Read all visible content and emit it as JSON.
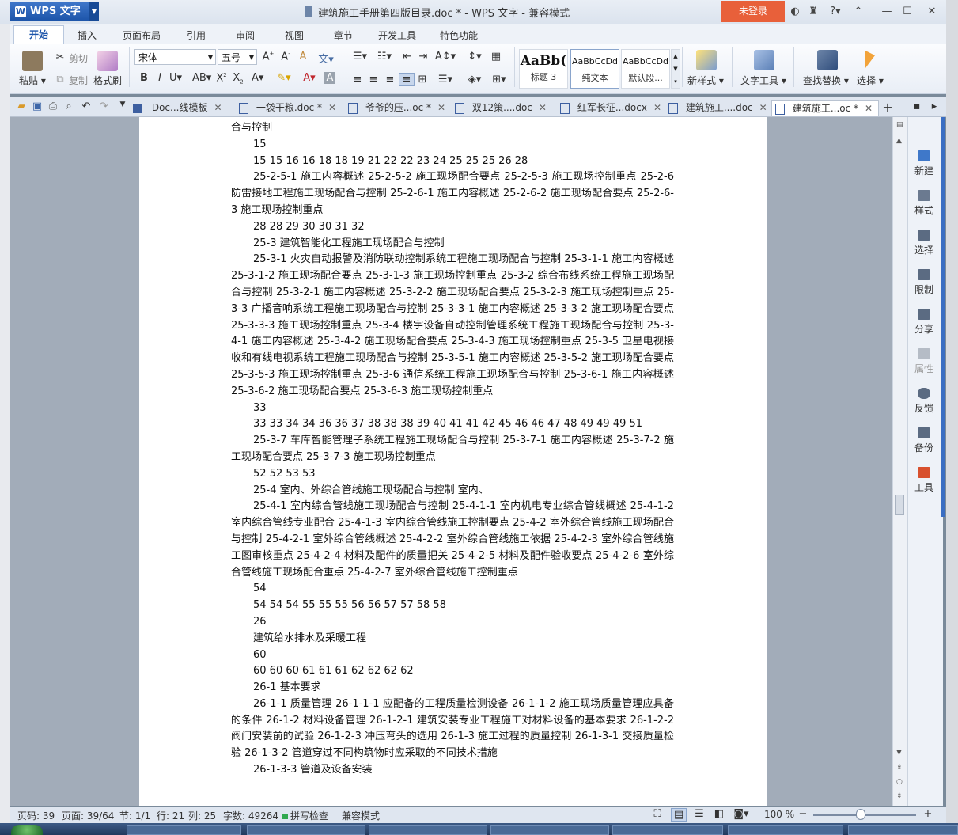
{
  "app": {
    "name": "WPS 文字",
    "doc_title": "建筑施工手册第四版目录.doc * - WPS 文字 - 兼容模式",
    "login": "未登录"
  },
  "menu": [
    "开始",
    "插入",
    "页面布局",
    "引用",
    "审阅",
    "视图",
    "章节",
    "开发工具",
    "特色功能"
  ],
  "ribbon": {
    "paste": "粘贴",
    "cut": "剪切",
    "copy": "复制",
    "format_painter": "格式刷",
    "font": "宋体",
    "size": "五号",
    "styles": [
      {
        "preview": "AaBb(",
        "name": "标题 3"
      },
      {
        "preview": "AaBbCcDd",
        "name": "纯文本"
      },
      {
        "preview": "AaBbCcDd",
        "name": "默认段..."
      }
    ],
    "new_style": "新样式",
    "text_tools": "文字工具",
    "find_replace": "查找替换",
    "select": "选择"
  },
  "doc_tabs": [
    {
      "label": "Doc...线模板"
    },
    {
      "label": "一袋干粮.doc *"
    },
    {
      "label": "爷爷的压...oc *"
    },
    {
      "label": "双12策....doc"
    },
    {
      "label": "红军长征...docx"
    },
    {
      "label": "建筑施工....doc"
    },
    {
      "label": "建筑施工...oc *"
    }
  ],
  "document": {
    "paragraphs": [
      {
        "text": "合与控制",
        "indent": false
      },
      {
        "text": "15",
        "indent": true
      },
      {
        "text": "15 15 16 16 18 18 19 21 22 22 23 24 25 25 25 26 28",
        "indent": true
      },
      {
        "text": "25-2-5-1 施工内容概述 25-2-5-2 施工现场配合要点 25-2-5-3 施工现场控制重点 25-2-6 防雷接地工程施工现场配合与控制 25-2-6-1 施工内容概述 25-2-6-2 施工现场配合要点 25-2-6-3 施工现场控制重点",
        "indent": true
      },
      {
        "text": "28 28 29 30 30 31 32",
        "indent": true
      },
      {
        "text": "25-3 建筑智能化工程施工现场配合与控制",
        "indent": true
      },
      {
        "text": "25-3-1 火灾自动报警及消防联动控制系统工程施工现场配合与控制 25-3-1-1 施工内容概述 25-3-1-2 施工现场配合要点 25-3-1-3 施工现场控制重点 25-3-2 综合布线系统工程施工现场配合与控制 25-3-2-1 施工内容概述 25-3-2-2 施工现场配合要点 25-3-2-3 施工现场控制重点 25-3-3 广播音响系统工程施工现场配合与控制 25-3-3-1 施工内容概述 25-3-3-2 施工现场配合要点 25-3-3-3 施工现场控制重点 25-3-4 楼宇设备自动控制管理系统工程施工现场配合与控制 25-3-4-1 施工内容概述 25-3-4-2 施工现场配合要点 25-3-4-3 施工现场控制重点 25-3-5 卫星电视接收和有线电视系统工程施工现场配合与控制 25-3-5-1 施工内容概述 25-3-5-2 施工现场配合要点 25-3-5-3 施工现场控制重点 25-3-6 通信系统工程施工现场配合与控制 25-3-6-1 施工内容概述 25-3-6-2 施工现场配合要点 25-3-6-3 施工现场控制重点",
        "indent": true
      },
      {
        "text": "33",
        "indent": true
      },
      {
        "text": "33 33 34 34 36 36 37 38 38 38 39 40 41 41 42 45 46 46 47 48 49 49 49 51",
        "indent": true
      },
      {
        "text": "25-3-7 车库智能管理子系统工程施工现场配合与控制 25-3-7-1 施工内容概述 25-3-7-2 施工现场配合要点 25-3-7-3 施工现场控制重点",
        "indent": true
      },
      {
        "text": "52 52 53 53",
        "indent": true
      },
      {
        "text": "25-4 室内、外综合管线施工现场配合与控制 室内、",
        "indent": true
      },
      {
        "text": "25-4-1 室内综合管线施工现场配合与控制 25-4-1-1 室内机电专业综合管线概述 25-4-1-2 室内综合管线专业配合 25-4-1-3 室内综合管线施工控制要点 25-4-2 室外综合管线施工现场配合与控制 25-4-2-1 室外综合管线概述 25-4-2-2 室外综合管线施工依据 25-4-2-3 室外综合管线施工图审核重点 25-4-2-4 材料及配件的质量把关 25-4-2-5 材料及配件验收要点 25-4-2-6 室外综合管线施工现场配合重点 25-4-2-7 室外综合管线施工控制重点",
        "indent": true
      },
      {
        "text": "54",
        "indent": true
      },
      {
        "text": "54 54 54 55 55 55 56 56 57 57 58 58",
        "indent": true
      },
      {
        "text": "26",
        "indent": true
      },
      {
        "text": "建筑给水排水及采暖工程",
        "indent": true
      },
      {
        "text": "60",
        "indent": true
      },
      {
        "text": "60 60 60 61 61 61 62 62 62 62",
        "indent": true
      },
      {
        "text": "26-1 基本要求",
        "indent": true
      },
      {
        "text": "26-1-1 质量管理 26-1-1-1 应配备的工程质量检测设备 26-1-1-2 施工现场质量管理应具备的条件 26-1-2 材料设备管理 26-1-2-1 建筑安装专业工程施工对材料设备的基本要求 26-1-2-2 阀门安装前的试验 26-1-2-3 冲压弯头的选用 26-1-3 施工过程的质量控制 26-1-3-1 交接质量检验 26-1-3-2 管道穿过不同构筑物时应采取的不同技术措施",
        "indent": true
      },
      {
        "text": "26-1-3-3 管道及设备安装",
        "indent": true
      }
    ]
  },
  "taskpane": [
    "新建",
    "样式",
    "选择",
    "限制",
    "分享",
    "属性",
    "反馈",
    "备份",
    "工具"
  ],
  "status": {
    "page_code": "页码: 39",
    "page": "页面: 39/64",
    "section": "节: 1/1",
    "row": "行: 21",
    "col": "列: 25",
    "words": "字数: 49264",
    "spell": "拼写检查",
    "mode": "兼容模式",
    "zoom": "100 %"
  },
  "zoom_fraction": 0.46
}
